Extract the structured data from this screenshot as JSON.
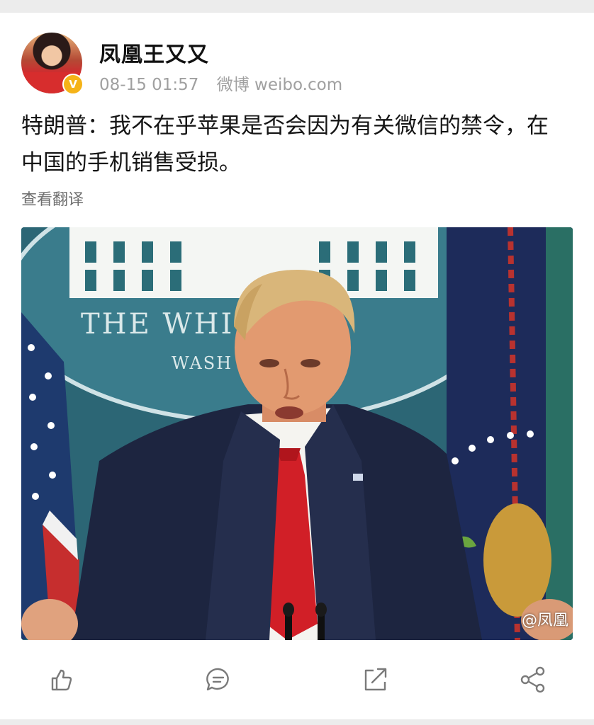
{
  "post": {
    "author": "凤凰王又又",
    "verified_badge": "V",
    "time": "08-15 01:57",
    "source": "微博 weibo.com",
    "text": "特朗普：我不在乎苹果是否会因为有关微信的禁令，在中国的手机销售受损。",
    "translate_label": "查看翻译"
  },
  "image": {
    "seal_text_line1": "THE WHI   OUSE",
    "seal_text_line2": "WASH",
    "watermark": "@凤凰"
  },
  "actions": [
    {
      "icon": "like-icon"
    },
    {
      "icon": "comment-icon"
    },
    {
      "icon": "repost-icon"
    },
    {
      "icon": "share-icon"
    }
  ],
  "colors": {
    "background": "#ececec",
    "card": "#ffffff",
    "meta_text": "#a0a0a0",
    "badge": "#f5b318"
  }
}
